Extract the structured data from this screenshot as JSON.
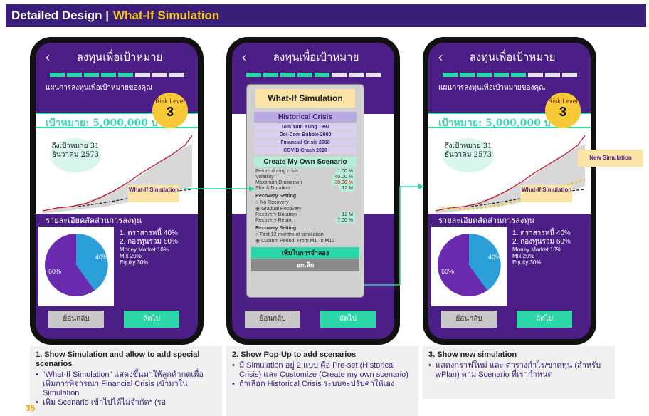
{
  "header": {
    "title_main": "Detailed Design |",
    "title_accent": "What-If Simulation"
  },
  "phone": {
    "back_icon": "‹",
    "title": "ลงทุนเพื่อเป้าหมาย",
    "plan_label": "แผนการลงทุนเพื่อเป้าหมายของคุณ",
    "goal": "เป้าหมาย: 5,000,000 บาท",
    "risk_label": "Risk Level",
    "risk_value": "3",
    "goal_bubble": "ถึงเป้าหมาย 31 ธันวาคม 2573",
    "whatif_label": "What-If Simulation",
    "detail_label": "รายละเอียดสัดส่วนการลงทุน",
    "alloc1": "1. ตราสารหนี้ 40%",
    "alloc2": "2. กองทุนรวม 60%",
    "sub1": "Money Market 10%",
    "sub2": "Mix 20%",
    "sub3": "Equity 30%",
    "pie_small": "40%",
    "pie_big": "60%",
    "back_btn": "ย้อนกลับ",
    "next_btn": "ถัดไป"
  },
  "popup": {
    "title": "What-If Simulation",
    "historical_title": "Historical Crisis",
    "crises": [
      "Tom Yum Kung 1997",
      "Dot-Com Bubble 2000",
      "Financial Crisis 2008",
      "COVID Crash 2020"
    ],
    "own_title": "Create My Own Scenario",
    "params": [
      {
        "k": "Return during crisis",
        "v": "1.00 %"
      },
      {
        "k": "Volatility",
        "v": "40.00 %"
      },
      {
        "k": "Maximum Drawdown",
        "v": "-30.00 %"
      },
      {
        "k": "Shock Duration",
        "v": "12 M"
      }
    ],
    "recovery_setting": "Recovery Setting",
    "no_recovery": "No Recovery",
    "gradual": "Gradual Recovery",
    "rec_params": [
      {
        "k": "Recovery Duration",
        "v": "12 M"
      },
      {
        "k": "Recovery Return",
        "v": "7.00 %"
      }
    ],
    "rec_setting2": "Recovery Setting",
    "first12": "First 12 months of simulation",
    "custom": "Custom Period: From",
    "from_val": "M1",
    "to_label": "To",
    "to_val": "M12",
    "add_btn": "เพิ่มในการจำลอง",
    "cancel_btn": "ยกเลิก"
  },
  "new_sim": "New Simulation",
  "captions": [
    {
      "title": "1. Show Simulation and allow to add special scenarios",
      "items": [
        "“What-If Simulation” แสดงขึ้นมาให้ลูกค้ากดเพื่อเพิ่มการพิจารณา Financial Crisis เข้ามาใน Simulation",
        "เพิ่ม Scenario เข้าไปได้ไม่จำกัด* (รอ"
      ]
    },
    {
      "title": "2. Show Pop-Up to add scenarios",
      "items": [
        "มี Simulation อยู่ 2 แบบ คือ Pre-set (Historical Crisis) และ Customize (Create my own scenario)",
        "ถ้าเลือก Historical Crisis ระบบจะปรับค่าให้เอง"
      ]
    },
    {
      "title": "3. Show new simulation",
      "items": [
        "แสดงกราฟใหม่ และ ตารางกำไร/ขาดทุน (สำหรับ wPlan) ตาม Scenario ที่เรากำหนด"
      ]
    }
  ],
  "page_number": "35"
}
